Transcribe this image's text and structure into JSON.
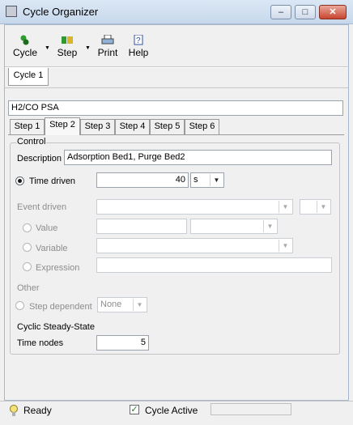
{
  "window": {
    "title": "Cycle Organizer",
    "minimize_glyph": "‒",
    "maximize_glyph": "□",
    "close_glyph": "✕"
  },
  "toolbar": {
    "cycle_label": "Cycle",
    "step_label": "Step",
    "print_label": "Print",
    "help_label": "Help",
    "dropdown_glyph": "▼"
  },
  "cycle_tab": {
    "label": "Cycle 1"
  },
  "cycle_name": "H2/CO PSA",
  "step_tabs": [
    "Step 1",
    "Step 2",
    "Step 3",
    "Step 4",
    "Step 5",
    "Step 6"
  ],
  "selected_step": "Step 2",
  "control": {
    "legend": "Control",
    "description_label": "Description",
    "description_value": "Adsorption Bed1, Purge Bed2",
    "time_driven_label": "Time driven",
    "time_value": "40",
    "time_unit": "s",
    "event_driven_label": "Event driven",
    "value_label": "Value",
    "variable_label": "Variable",
    "expression_label": "Expression",
    "other_label": "Other",
    "step_dependent_label": "Step dependent",
    "step_dependent_value": "None",
    "css_label": "Cyclic Steady-State",
    "time_nodes_label": "Time nodes",
    "time_nodes_value": "5"
  },
  "statusbar": {
    "ready": "Ready",
    "cycle_active": "Cycle Active",
    "checkmark": "✓"
  }
}
